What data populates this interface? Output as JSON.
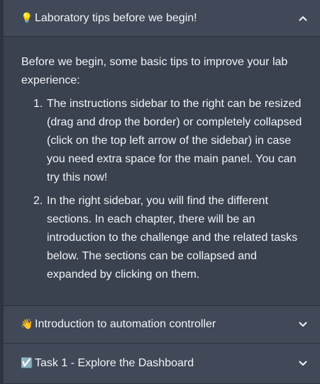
{
  "sections": {
    "tips": {
      "emoji": "💡",
      "emoji_icon": "lightbulb-icon",
      "title": "Laboratory tips before we begin!",
      "expanded": true,
      "intro": "Before we begin, some basic tips to improve your lab experience:",
      "items": [
        {
          "number": "1.",
          "text": "The instructions sidebar to the right can be resized (drag and drop the border) or completely collapsed (click on the top left arrow of the sidebar) in case you need extra space for the main panel. You can try this now!"
        },
        {
          "number": "2.",
          "text": "In the right sidebar, you will find the different sections. In each chapter, there will be an introduction to the challenge and the related tasks below. The sections can be collapsed and expanded by clicking on them."
        }
      ]
    },
    "intro": {
      "emoji": "👋",
      "emoji_icon": "waving-hand-icon",
      "title": "Introduction to automation controller",
      "expanded": false
    },
    "task1": {
      "emoji": "☑️",
      "emoji_icon": "check-box-icon",
      "title": "Task 1 - Explore the Dashboard",
      "expanded": false
    }
  },
  "colors": {
    "background": "#2e3440",
    "header": "#414958",
    "body": "#3a4250",
    "text": "#f2f4f7"
  }
}
